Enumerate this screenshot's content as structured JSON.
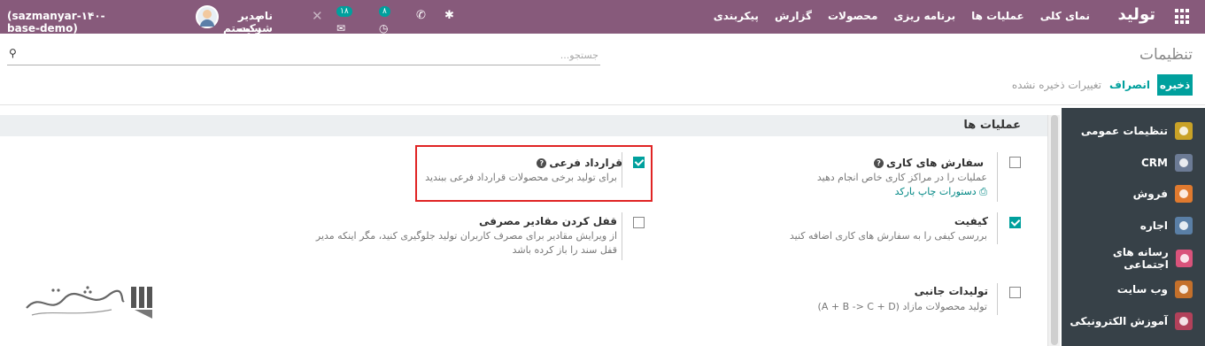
{
  "navbar": {
    "brand": "تولید",
    "menu": [
      "نمای کلی",
      "عملیات ها",
      "برنامه ریزی",
      "محصولات",
      "گزارش",
      "پیکربندی"
    ],
    "company": "نام شرکت شما",
    "user": "مدیر سیستم",
    "database": "(sazmanyar-۱۴۰-base-demo)",
    "chat_count": "۱۸",
    "activity_count": "۸"
  },
  "control_panel": {
    "breadcrumb": "تنظیمات",
    "search_placeholder": "جستجو...",
    "save_label": "ذخیره",
    "discard_label": "انصراف",
    "unsaved_label": "تغییرات ذخیره نشده"
  },
  "sidebar": {
    "items": [
      {
        "label": "تنظیمات عمومی",
        "color": "#c9a227",
        "icon": "gear-icon"
      },
      {
        "label": "CRM",
        "color": "#6c7b95",
        "icon": "crm-icon"
      },
      {
        "label": "فروش",
        "color": "#e07a2f",
        "icon": "sales-icon"
      },
      {
        "label": "اجاره",
        "color": "#5a7fa6",
        "icon": "rental-icon"
      },
      {
        "label": "رسانه های اجتماعی",
        "color": "#d9537b",
        "icon": "social-icon"
      },
      {
        "label": "وب سایت",
        "color": "#c4702b",
        "icon": "website-icon"
      },
      {
        "label": "آموزش الکترونیکی",
        "color": "#b2415a",
        "icon": "elearning-icon"
      }
    ]
  },
  "section": {
    "title": "عملیات ها",
    "settings": [
      {
        "title": "سفارش های کاری",
        "has_help": true,
        "checked": false,
        "desc": "عملیات را در مراکز کاری خاص انجام دهید",
        "link": "دستورات چاپ بارکد"
      },
      {
        "title": "قرارداد فرعی",
        "has_help": true,
        "checked": true,
        "desc": "برای تولید برخی محصولات قرارداد فرعی ببندید"
      },
      {
        "title": "کیفیت",
        "has_help": false,
        "checked": true,
        "desc": "بررسی کیفی را به سفارش های کاری اضافه کنید"
      },
      {
        "title": "قفل کردن مقادیر مصرفی",
        "has_help": false,
        "checked": false,
        "desc": "از ویرایش مقادیر برای مصرف کاربران تولید جلوگیری کنید، مگر اینکه مدیر قفل سند را باز کرده باشد"
      },
      {
        "title": "تولیدات جانبی",
        "has_help": false,
        "checked": false,
        "desc": "تولید محصولات مازاد (A + B -> C + D)"
      }
    ]
  }
}
